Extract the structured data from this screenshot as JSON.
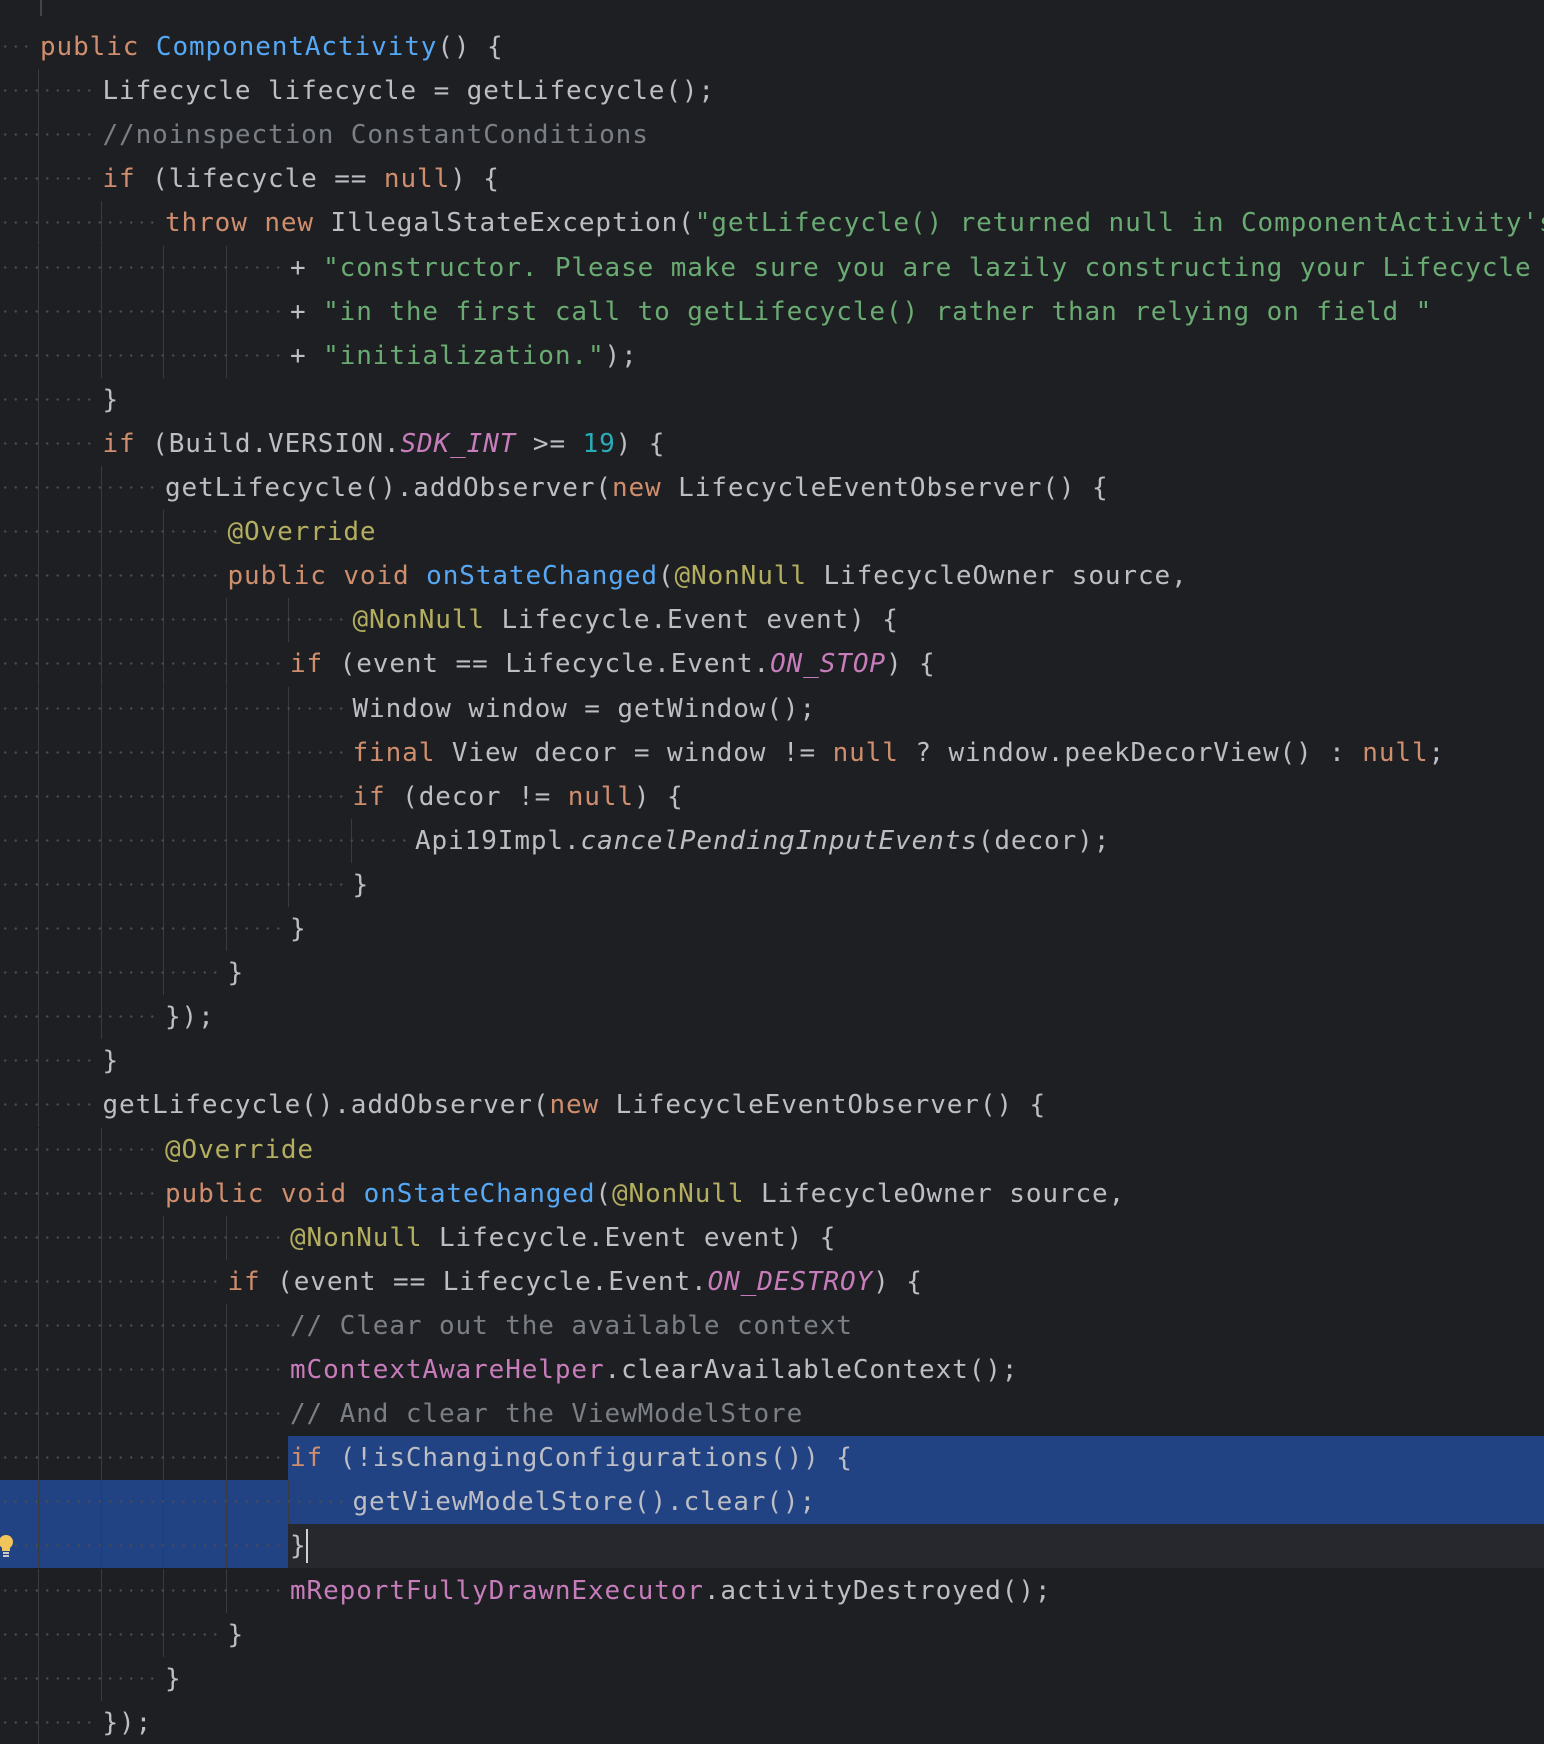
{
  "editor": {
    "language": "Java",
    "colors": {
      "background": "#1e1f22",
      "text": "#bcbec4",
      "keyword": "#cf8e6d",
      "method_declaration": "#56a8f5",
      "string": "#6aab73",
      "comment": "#7a7e85",
      "number": "#2aacb8",
      "annotation": "#b3ae60",
      "field": "#c77dbb",
      "selection": "#214283",
      "current_line": "#26282e",
      "indent_guide": "#393b40"
    },
    "icons": {
      "intention_bulb": "lightbulb-icon"
    },
    "lines": [
      {
        "indent": 0,
        "tokens": [
          [
            "kw",
            "public"
          ],
          [
            "t",
            " "
          ],
          [
            "fn",
            "ComponentActivity"
          ],
          [
            "t",
            "() {"
          ]
        ]
      },
      {
        "indent": 1,
        "tokens": [
          [
            "t",
            "Lifecycle lifecycle = getLifecycle();"
          ]
        ]
      },
      {
        "indent": 1,
        "tokens": [
          [
            "cm",
            "//noinspection ConstantConditions"
          ]
        ]
      },
      {
        "indent": 1,
        "tokens": [
          [
            "kw",
            "if"
          ],
          [
            "t",
            " (lifecycle == "
          ],
          [
            "kw",
            "null"
          ],
          [
            "t",
            ") {"
          ]
        ]
      },
      {
        "indent": 2,
        "tokens": [
          [
            "kw",
            "throw new"
          ],
          [
            "t",
            " IllegalStateException("
          ],
          [
            "str",
            "\"getLifecycle() returned null in ComponentActivity's \""
          ]
        ]
      },
      {
        "indent": 4,
        "tokens": [
          [
            "t",
            "+ "
          ],
          [
            "str",
            "\"constructor. Please make sure you are lazily constructing your Lifecycle \""
          ]
        ]
      },
      {
        "indent": 4,
        "tokens": [
          [
            "t",
            "+ "
          ],
          [
            "str",
            "\"in the first call to getLifecycle() rather than relying on field \""
          ]
        ]
      },
      {
        "indent": 4,
        "tokens": [
          [
            "t",
            "+ "
          ],
          [
            "str",
            "\"initialization.\""
          ],
          [
            "t",
            ");"
          ]
        ]
      },
      {
        "indent": 1,
        "tokens": [
          [
            "t",
            "}"
          ]
        ]
      },
      {
        "indent": 1,
        "tokens": [
          [
            "kw",
            "if"
          ],
          [
            "t",
            " (Build.VERSION."
          ],
          [
            "sfld",
            "SDK_INT"
          ],
          [
            "t",
            " >= "
          ],
          [
            "num",
            "19"
          ],
          [
            "t",
            ") {"
          ]
        ]
      },
      {
        "indent": 2,
        "tokens": [
          [
            "t",
            "getLifecycle().addObserver("
          ],
          [
            "kw",
            "new"
          ],
          [
            "t",
            " LifecycleEventObserver() {"
          ]
        ]
      },
      {
        "indent": 3,
        "tokens": [
          [
            "ann",
            "@Override"
          ]
        ]
      },
      {
        "indent": 3,
        "tokens": [
          [
            "kw",
            "public void"
          ],
          [
            "t",
            " "
          ],
          [
            "fn",
            "onStateChanged"
          ],
          [
            "t",
            "("
          ],
          [
            "ann",
            "@NonNull"
          ],
          [
            "t",
            " LifecycleOwner source,"
          ]
        ]
      },
      {
        "indent": 5,
        "tokens": [
          [
            "ann",
            "@NonNull"
          ],
          [
            "t",
            " Lifecycle.Event event) {"
          ]
        ]
      },
      {
        "indent": 4,
        "tokens": [
          [
            "kw",
            "if"
          ],
          [
            "t",
            " (event == Lifecycle.Event."
          ],
          [
            "sfld",
            "ON_STOP"
          ],
          [
            "t",
            ") {"
          ]
        ]
      },
      {
        "indent": 5,
        "tokens": [
          [
            "t",
            "Window window = getWindow();"
          ]
        ]
      },
      {
        "indent": 5,
        "tokens": [
          [
            "kw",
            "final"
          ],
          [
            "t",
            " View decor = window != "
          ],
          [
            "kw",
            "null"
          ],
          [
            "t",
            " ? window.peekDecorView() : "
          ],
          [
            "kw",
            "null"
          ],
          [
            "t",
            ";"
          ]
        ]
      },
      {
        "indent": 5,
        "tokens": [
          [
            "kw",
            "if"
          ],
          [
            "t",
            " (decor != "
          ],
          [
            "kw",
            "null"
          ],
          [
            "t",
            ") {"
          ]
        ]
      },
      {
        "indent": 6,
        "tokens": [
          [
            "t",
            "Api19Impl."
          ],
          [
            "it",
            "cancelPendingInputEvents"
          ],
          [
            "t",
            "(decor);"
          ]
        ]
      },
      {
        "indent": 5,
        "tokens": [
          [
            "t",
            "}"
          ]
        ]
      },
      {
        "indent": 4,
        "tokens": [
          [
            "t",
            "}"
          ]
        ]
      },
      {
        "indent": 3,
        "tokens": [
          [
            "t",
            "}"
          ]
        ]
      },
      {
        "indent": 2,
        "tokens": [
          [
            "t",
            "});"
          ]
        ]
      },
      {
        "indent": 1,
        "tokens": [
          [
            "t",
            "}"
          ]
        ]
      },
      {
        "indent": 1,
        "tokens": [
          [
            "t",
            "getLifecycle().addObserver("
          ],
          [
            "kw",
            "new"
          ],
          [
            "t",
            " LifecycleEventObserver() {"
          ]
        ]
      },
      {
        "indent": 2,
        "tokens": [
          [
            "ann",
            "@Override"
          ]
        ]
      },
      {
        "indent": 2,
        "tokens": [
          [
            "kw",
            "public void"
          ],
          [
            "t",
            " "
          ],
          [
            "fn",
            "onStateChanged"
          ],
          [
            "t",
            "("
          ],
          [
            "ann",
            "@NonNull"
          ],
          [
            "t",
            " LifecycleOwner source,"
          ]
        ]
      },
      {
        "indent": 4,
        "tokens": [
          [
            "ann",
            "@NonNull"
          ],
          [
            "t",
            " Lifecycle.Event event) {"
          ]
        ]
      },
      {
        "indent": 3,
        "tokens": [
          [
            "kw",
            "if"
          ],
          [
            "t",
            " (event == Lifecycle.Event."
          ],
          [
            "sfld",
            "ON_DESTROY"
          ],
          [
            "t",
            ") {"
          ]
        ]
      },
      {
        "indent": 4,
        "tokens": [
          [
            "cm",
            "// Clear out the available context"
          ]
        ]
      },
      {
        "indent": 4,
        "tokens": [
          [
            "fld",
            "mContextAwareHelper"
          ],
          [
            "t",
            ".clearAvailableContext();"
          ]
        ]
      },
      {
        "indent": 4,
        "tokens": [
          [
            "cm",
            "// And clear the ViewModelStore"
          ]
        ]
      },
      {
        "indent": 4,
        "tokens": [
          [
            "kw",
            "if"
          ],
          [
            "t",
            " (!isChangingConfigurations()) {"
          ]
        ]
      },
      {
        "indent": 5,
        "tokens": [
          [
            "t",
            "getViewModelStore().clear();"
          ]
        ]
      },
      {
        "indent": 4,
        "tokens": [
          [
            "t",
            "}"
          ]
        ]
      },
      {
        "indent": 4,
        "tokens": [
          [
            "fld",
            "mReportFullyDrawnExecutor"
          ],
          [
            "t",
            ".activityDestroyed();"
          ]
        ]
      },
      {
        "indent": 3,
        "tokens": [
          [
            "t",
            "}"
          ]
        ]
      },
      {
        "indent": 2,
        "tokens": [
          [
            "t",
            "}"
          ]
        ]
      },
      {
        "indent": 1,
        "tokens": [
          [
            "t",
            "});"
          ]
        ]
      }
    ]
  }
}
